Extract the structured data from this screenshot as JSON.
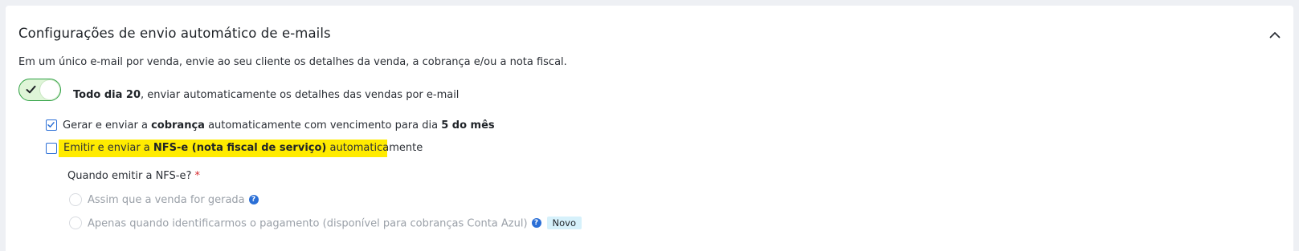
{
  "section": {
    "title": "Configurações de envio automático de e-mails",
    "subtitle": "Em um único e-mail por venda, envie ao seu cliente os detalhes da venda, a cobrança e/ou a nota fiscal.",
    "collapse_icon": "chevron-up-icon"
  },
  "toggle": {
    "state": "on",
    "label_bold": "Todo dia 20",
    "label_rest": ", enviar automaticamente os detalhes das vendas por e-mail",
    "accent_color": "#2ea043"
  },
  "options": {
    "charge": {
      "checked": true,
      "text_1": "Gerar e enviar a ",
      "bold_1": "cobrança",
      "text_2": " automaticamente com vencimento para dia ",
      "bold_2": "5 do mês"
    },
    "nfse": {
      "checked": false,
      "text_1": "Emitir e enviar a ",
      "bold_1": "NFS-e (nota fiscal de serviço)",
      "text_2": " automaticamente",
      "highlight_color": "#ffeb00"
    }
  },
  "nfse_timing": {
    "question": "Quando emitir a NFS-e?",
    "required_mark": "*",
    "choices": [
      {
        "label": "Assim que a venda for gerada",
        "selected": false,
        "disabled": true,
        "help_icon": "help-icon"
      },
      {
        "label": "Apenas quando identificarmos o pagamento (disponível para cobranças Conta Azul)",
        "selected": false,
        "disabled": true,
        "help_icon": "help-icon",
        "badge": "Novo"
      }
    ]
  },
  "help_glyph": "?"
}
